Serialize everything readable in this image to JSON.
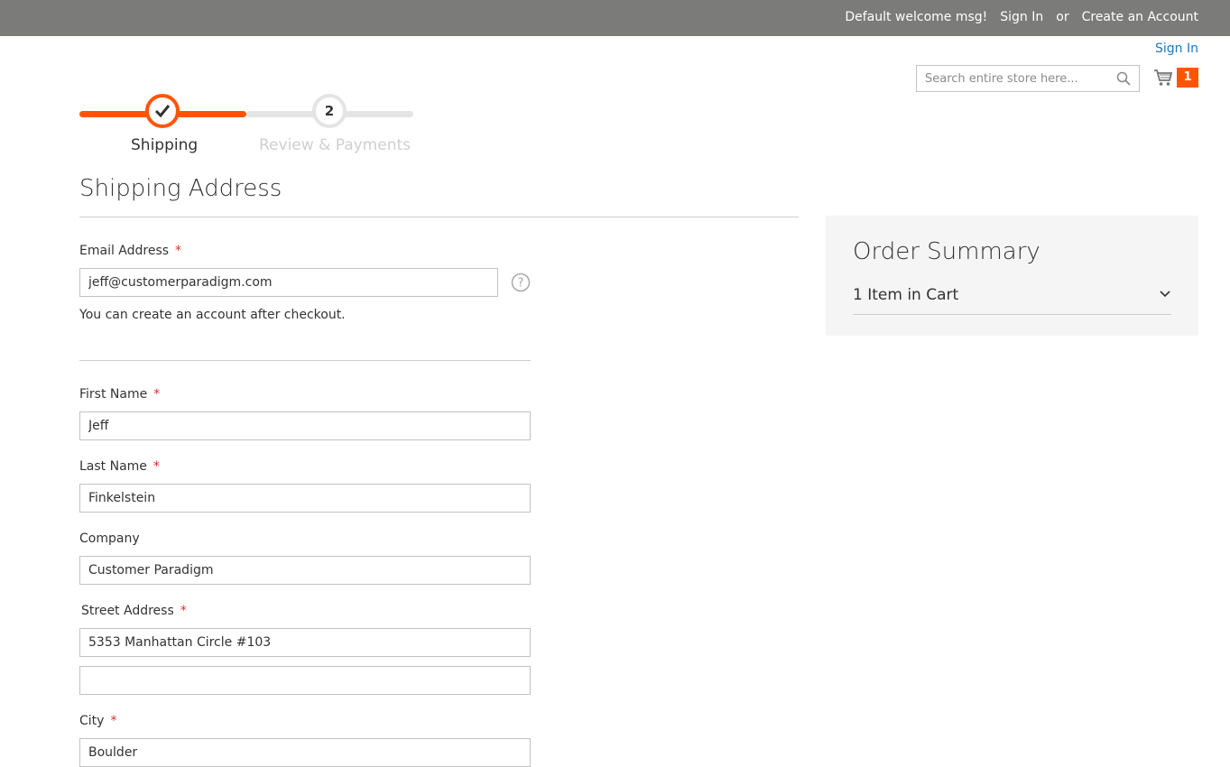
{
  "header": {
    "welcome": "Default welcome msg!",
    "sign_in": "Sign In",
    "or": "or",
    "create_account": "Create an Account",
    "sign_in_link": "Sign In",
    "search_placeholder": "Search entire store here...",
    "cart_count": "1",
    "brand_color": "#ff5501",
    "link_color": "#1979c3"
  },
  "progress": {
    "steps": [
      {
        "label": "Shipping",
        "state": "complete"
      },
      {
        "label": "Review & Payments",
        "number": "2",
        "state": "pending"
      }
    ]
  },
  "shipping": {
    "title": "Shipping Address",
    "email": {
      "label": "Email Address",
      "required": "*",
      "value": "jeff@customerparadigm.com"
    },
    "account_note": "You can create an account after checkout.",
    "first_name": {
      "label": "First Name",
      "required": "*",
      "value": "Jeff"
    },
    "last_name": {
      "label": "Last Name",
      "required": "*",
      "value": "Finkelstein"
    },
    "company": {
      "label": "Company",
      "value": "Customer Paradigm"
    },
    "street": {
      "label": "Street Address",
      "required": "*",
      "line1": "5353 Manhattan Circle #103",
      "line2": ""
    },
    "city": {
      "label": "City",
      "required": "*",
      "value": "Boulder"
    }
  },
  "summary": {
    "title": "Order Summary",
    "items": "1 Item in Cart"
  }
}
